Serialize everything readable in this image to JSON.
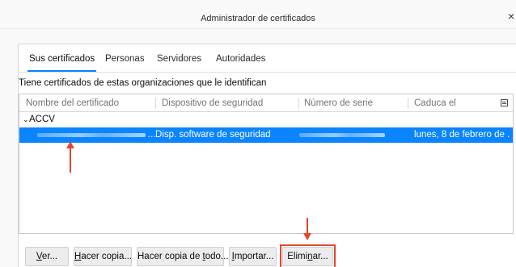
{
  "window": {
    "title": "Administrador de certificados",
    "close_glyph": "×"
  },
  "tabs": [
    {
      "label": "Sus certificados",
      "selected": true
    },
    {
      "label": "Personas",
      "selected": false
    },
    {
      "label": "Servidores",
      "selected": false
    },
    {
      "label": "Autoridades",
      "selected": false
    }
  ],
  "caption": "Tiene certificados de estas organizaciones que le identifican",
  "table": {
    "columns": [
      "Nombre del certificado",
      "Dispositivo de seguridad",
      "Número de serie",
      "Caduca el"
    ],
    "column_picker_icon": "column-picker-icon",
    "group": {
      "twisty": "⌄",
      "label": "ACCV"
    },
    "rows": [
      {
        "name": "…",
        "device": "Disp. software de seguridad",
        "expires": "lunes, 8 de febrero de ...",
        "selected": true
      }
    ]
  },
  "buttons": {
    "ver": {
      "pre": "",
      "key": "V",
      "post": "er..."
    },
    "hacer_copia": {
      "pre": "",
      "key": "H",
      "post": "acer copia..."
    },
    "hacer_copia_todo": {
      "pre": "Hacer copia de ",
      "key": "t",
      "post": "odo..."
    },
    "importar": {
      "pre": "",
      "key": "I",
      "post": "mportar..."
    },
    "eliminar": {
      "pre": "Elimi",
      "key": "n",
      "post": "ar..."
    }
  },
  "colors": {
    "accent": "#0a84ff",
    "annotation": "#e2462f"
  }
}
